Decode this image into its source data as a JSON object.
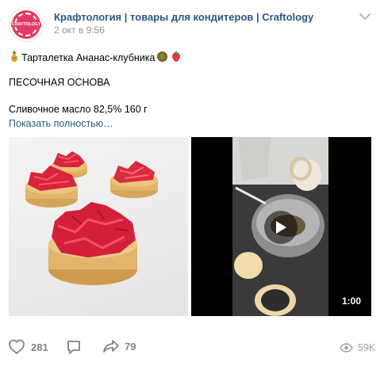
{
  "post": {
    "group_name": "Крафтология | товары для кондитеров | Craftology",
    "time": "2 окт в 9:56",
    "avatar_label": "CRAFTOLOGY",
    "text": {
      "title": "Тарталетка Ананас-клубника",
      "section": "ПЕСОЧНАЯ ОСНОВА",
      "ingredient": "Сливочное масло 82,5% 160 г"
    },
    "show_more": "Показать полностью…",
    "video_duration": "1:00"
  },
  "footer": {
    "likes": "281",
    "shares": "79",
    "views": "59K"
  },
  "colors": {
    "link": "#2a5885",
    "secondary": "#939393",
    "icon": "#828282"
  },
  "icons": [
    "chevron-down-icon",
    "pineapple-icon",
    "kiwi-icon",
    "strawberry-icon",
    "play-icon",
    "heart-icon",
    "comment-icon",
    "share-icon",
    "eye-icon"
  ]
}
